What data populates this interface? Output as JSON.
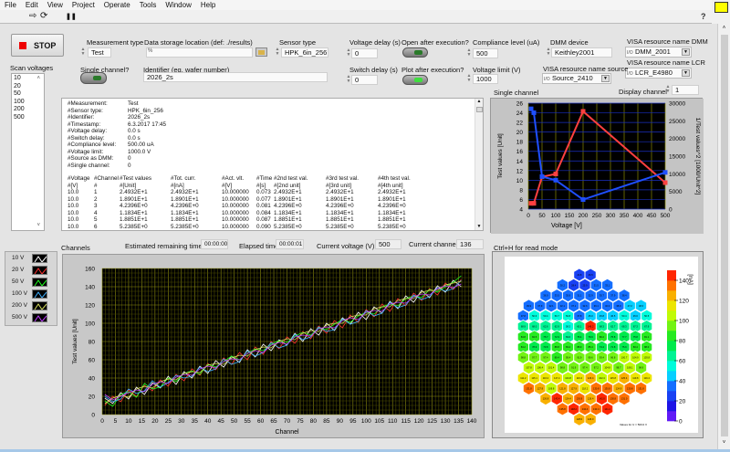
{
  "menu": [
    "File",
    "Edit",
    "View",
    "Project",
    "Operate",
    "Tools",
    "Window",
    "Help"
  ],
  "toolbar": {
    "run": "⇨",
    "run_continuous": "⟳",
    "pause": "❚❚",
    "help": "?"
  },
  "stop": {
    "label": "STOP"
  },
  "controls": {
    "measurement_type": {
      "label": "Measurement type",
      "value": "Test"
    },
    "data_storage": {
      "label": "Data storage location (def: ./results)",
      "value": ""
    },
    "sensor_type": {
      "label": "Sensor type",
      "value": "HPK_6in_256"
    },
    "voltage_delay": {
      "label": "Voltage delay (s)",
      "value": "0"
    },
    "switch_delay": {
      "label": "Switch delay (s)",
      "value": "0"
    },
    "open_after": {
      "label": "Open after execution?"
    },
    "plot_after": {
      "label": "Plot after execution?"
    },
    "compliance": {
      "label": "Compliance  level (uA)",
      "value": "500"
    },
    "voltage_limit": {
      "label": "Voltage limit (V)",
      "value": "1000"
    },
    "dmm_device": {
      "label": "DMM device",
      "value": "Keithley2001"
    },
    "visa_dmm": {
      "label": "VISA resource name DMM",
      "value": "DMM_2001"
    },
    "visa_lcr": {
      "label": "VISA resource name LCR",
      "value": "LCR_E4980"
    },
    "visa_source": {
      "label": "VISA resource name source",
      "value": "Source_2410"
    },
    "display_channel": {
      "label": "Display channel",
      "value": "1"
    },
    "single_channel": {
      "label": "Single channel?"
    },
    "identifier": {
      "label": "Identifier (eg. wafer number)",
      "value": "2026_2s"
    },
    "scan_voltages": {
      "label": "Scan voltages",
      "items": [
        "10",
        "20",
        "50",
        "100",
        "200",
        "500"
      ]
    }
  },
  "log": {
    "header": [
      [
        "#Measurement:",
        "Test"
      ],
      [
        "#Sensor type:",
        "HPK_6in_256"
      ],
      [
        "#Identifier:",
        "2026_2s"
      ],
      [
        "#Timestamp:",
        "6.3.2017 17:45"
      ],
      [
        "#Voltage delay:",
        "0.0 s"
      ],
      [
        "#Switch delay:",
        "0.0 s"
      ],
      [
        "#Compliance level:",
        "500.00 uA"
      ],
      [
        "#Voltage limit:",
        "1000.0 V"
      ],
      [
        "#Source as DMM:",
        "0"
      ],
      [
        "#Single channel:",
        "0"
      ]
    ],
    "columns": [
      "#Voltage",
      "#Channel",
      "#Test values",
      "#Tot. curr.",
      "#Act. vlt.",
      "#Time",
      "#2nd test val.",
      "#3rd test val.",
      "#4th test val."
    ],
    "units": [
      "#[V]",
      "#",
      "#[Unit]",
      "#[nA]",
      "#[V]",
      "#[s]",
      "#[2nd unit]",
      "#[3rd unit]",
      "#[4th unit]"
    ],
    "rows": [
      [
        "10.0",
        "1",
        "2.4932E+1",
        "2.4932E+1",
        "10.000000",
        "0.073",
        "2.4932E+1",
        "2.4932E+1",
        "2.4932E+1"
      ],
      [
        "10.0",
        "2",
        "1.8901E+1",
        "1.8901E+1",
        "10.000000",
        "0.077",
        "1.8901E+1",
        "1.8901E+1",
        "1.8901E+1"
      ],
      [
        "10.0",
        "3",
        "4.2396E+0",
        "4.2396E+0",
        "10.000000",
        "0.081",
        "4.2396E+0",
        "4.2396E+0",
        "4.2396E+0"
      ],
      [
        "10.0",
        "4",
        "1.1834E+1",
        "1.1834E+1",
        "10.000000",
        "0.084",
        "1.1834E+1",
        "1.1834E+1",
        "1.1834E+1"
      ],
      [
        "10.0",
        "5",
        "1.8851E+1",
        "1.8851E+1",
        "10.000000",
        "0.087",
        "1.8851E+1",
        "1.8851E+1",
        "1.8851E+1"
      ],
      [
        "10.0",
        "6",
        "5.2385E+0",
        "5.2385E+0",
        "10.000000",
        "0.090",
        "5.2385E+0",
        "5.2385E+0",
        "5.2385E+0"
      ]
    ]
  },
  "status": {
    "channels_label": "Channels",
    "remaining": {
      "label": "Estimated remaining time",
      "value": "00:00:00"
    },
    "elapsed": {
      "label": "Elapsed time",
      "value": "00:00:01"
    },
    "current_voltage": {
      "label": "Current voltage (V)",
      "value": "500"
    },
    "current_channel": {
      "label": "Current channel",
      "value": "136"
    },
    "single_channel_label": "Single channel",
    "read_mode_hint": "Ctrl+H for read mode"
  },
  "chart_data": [
    {
      "type": "line",
      "title": "",
      "xlabel": "Voltage [V]",
      "ylabel": "Test values [Unit]",
      "y2label": "1/Test values^2 [1000/Unit^2]",
      "xlim": [
        0,
        500
      ],
      "ylim": [
        4,
        26
      ],
      "y2lim": [
        0,
        30000
      ],
      "xticks": [
        "0",
        "50",
        "100",
        "150",
        "200",
        "250",
        "300",
        "350",
        "400",
        "450",
        "500"
      ],
      "yticks": [
        "4",
        "6",
        "8",
        "10",
        "12",
        "14",
        "16",
        "18",
        "20",
        "22",
        "24",
        "26"
      ],
      "y2ticks": [
        "0",
        "5000",
        "10000",
        "15000",
        "20000",
        "25000",
        "30000"
      ],
      "x": [
        10,
        20,
        50,
        100,
        200,
        500
      ],
      "series": [
        {
          "axis": "left",
          "color": "#ff4040",
          "values": [
            5.2,
            5.2,
            10.7,
            11.3,
            24.3,
            9.5
          ]
        },
        {
          "axis": "right",
          "color": "#1f4fff",
          "values": [
            28400,
            27300,
            9200,
            8200,
            2700,
            10400
          ]
        }
      ]
    },
    {
      "type": "line",
      "title": "",
      "xlabel": "Channel",
      "ylabel": "Test values [Unit]",
      "xlim": [
        0,
        140
      ],
      "ylim": [
        0,
        160
      ],
      "grid": true,
      "xticks": [
        "0",
        "5",
        "10",
        "15",
        "20",
        "25",
        "30",
        "35",
        "40",
        "45",
        "50",
        "55",
        "60",
        "65",
        "70",
        "75",
        "80",
        "85",
        "90",
        "95",
        "100",
        "105",
        "110",
        "115",
        "120",
        "125",
        "130",
        "135",
        "140"
      ],
      "yticks": [
        "0",
        "20",
        "40",
        "60",
        "80",
        "100",
        "120",
        "140",
        "160"
      ],
      "x": [
        1,
        4,
        7,
        10,
        13,
        16,
        19,
        22,
        25,
        28,
        31,
        34,
        37,
        40,
        43,
        46,
        49,
        52,
        55,
        58,
        61,
        64,
        67,
        70,
        73,
        76,
        79,
        82,
        85,
        88,
        91,
        94,
        97,
        100,
        103,
        106,
        109,
        112,
        115,
        118,
        121,
        124,
        127,
        130,
        133,
        136
      ],
      "series": [
        {
          "name": "10 V",
          "color": "#ffffff",
          "values": [
            18,
            12,
            24,
            17,
            30,
            22,
            35,
            29,
            42,
            33,
            47,
            40,
            53,
            45,
            59,
            52,
            64,
            57,
            71,
            63,
            77,
            70,
            82,
            76,
            89,
            80,
            94,
            87,
            100,
            92,
            106,
            99,
            112,
            104,
            118,
            111,
            124,
            116,
            130,
            123,
            136,
            128,
            141,
            134,
            147,
            140
          ]
        },
        {
          "name": "20 V",
          "color": "#ff3030",
          "values": [
            10,
            20,
            14,
            27,
            20,
            32,
            26,
            38,
            31,
            44,
            37,
            50,
            43,
            56,
            49,
            62,
            55,
            68,
            60,
            74,
            66,
            80,
            72,
            85,
            78,
            91,
            83,
            97,
            89,
            103,
            95,
            109,
            101,
            115,
            107,
            121,
            113,
            127,
            119,
            133,
            125,
            138,
            131,
            144,
            137,
            148
          ]
        },
        {
          "name": "50 V",
          "color": "#20ff20",
          "values": [
            15,
            9,
            22,
            25,
            19,
            34,
            28,
            30,
            40,
            36,
            45,
            48,
            44,
            55,
            52,
            58,
            64,
            60,
            67,
            72,
            70,
            77,
            81,
            79,
            86,
            90,
            87,
            95,
            93,
            99,
            104,
            101,
            108,
            112,
            110,
            118,
            121,
            119,
            127,
            130,
            128,
            137,
            134,
            140,
            145,
            152
          ]
        },
        {
          "name": "100 V",
          "color": "#40b0ff",
          "values": [
            20,
            14,
            17,
            28,
            23,
            26,
            37,
            30,
            35,
            43,
            40,
            42,
            52,
            47,
            50,
            61,
            55,
            58,
            70,
            64,
            68,
            79,
            73,
            76,
            88,
            82,
            85,
            96,
            91,
            93,
            105,
            99,
            102,
            114,
            108,
            111,
            123,
            117,
            120,
            131,
            126,
            129,
            139,
            135,
            138,
            147
          ]
        },
        {
          "name": "200 V",
          "color": "#d8e060",
          "values": [
            12,
            18,
            21,
            19,
            28,
            31,
            29,
            36,
            39,
            38,
            45,
            47,
            46,
            54,
            56,
            55,
            62,
            65,
            64,
            71,
            74,
            73,
            80,
            83,
            82,
            89,
            92,
            91,
            98,
            100,
            100,
            107,
            109,
            109,
            116,
            118,
            118,
            125,
            127,
            127,
            134,
            136,
            136,
            142,
            144,
            146
          ]
        },
        {
          "name": "500 V",
          "color": "#c040ff",
          "values": [
            22,
            16,
            20,
            24,
            27,
            25,
            33,
            36,
            34,
            41,
            44,
            43,
            50,
            53,
            51,
            58,
            61,
            60,
            67,
            70,
            68,
            76,
            79,
            77,
            85,
            87,
            86,
            94,
            96,
            95,
            103,
            106,
            104,
            112,
            114,
            113,
            121,
            123,
            122,
            129,
            132,
            131,
            138,
            141,
            139,
            143
          ]
        }
      ]
    },
    {
      "type": "heatmap",
      "title": "",
      "colorbar_label": "[nA]",
      "clim": [
        0,
        150
      ],
      "colorbar_ticks": [
        "0",
        "20",
        "40",
        "60",
        "80",
        "100",
        "120",
        "140"
      ],
      "footnote": "Values for U = 500.0 V",
      "rows": [
        [
          24.8,
          26.5
        ],
        [
          30.2,
          28.4,
          25.9,
          31.5,
          33.1
        ],
        [
          36.0,
          33.5,
          35.9,
          31.1,
          32.9,
          35.7,
          37.9,
          38.4
        ],
        [
          39.9,
          37.9,
          32.1,
          32.1,
          37.1,
          32.6,
          36.1,
          32.3,
          38.9,
          47.2,
          48.6
        ],
        [
          37.8,
          50.6,
          50.4,
          50.7,
          50.8,
          37.8,
          45.0,
          45.8,
          46.5,
          50.4,
          45.6,
          50.5
        ],
        [
          68.9,
          68.0,
          62.6,
          62.9,
          58.3,
          60.1,
          146.2,
          68.3,
          62.7,
          68.3,
          67.3,
          67.9
        ],
        [
          84.8,
          84.5,
          75.7,
          72.9,
          69.6,
          75.4,
          78.9,
          80.2,
          75.8,
          77.7,
          75.8,
          81.1
        ],
        [
          84.2,
          78.9,
          73.8,
          88.8,
          83.4,
          88.9,
          85.4,
          74.4,
          71.8,
          75.9,
          83.4,
          88.0
        ],
        [
          98.8,
          97.7,
          97.4,
          89.4,
          95.4,
          91.9,
          99.6,
          93.4,
          96.8,
          100.7,
          104.9,
          103.8
        ],
        [
          107.8,
          106.4,
          101.4,
          98.8,
          91.9,
          97.4,
          97.2,
          104.8,
          98.7,
          108.1,
          98.9
        ],
        [
          111.2,
          115.1,
          116.2,
          117.4,
          104.8,
          116.4,
          123.4,
          102.4,
          115.8,
          125.4,
          119.8,
          119.4
        ],
        [
          131.8,
          127.8,
          109.8,
          121.8,
          127.9,
          118.2,
          130.8,
          130.8,
          124.9,
          130.8,
          131.8
        ],
        [
          126.8,
          143.4,
          124.4,
          130.8,
          126.4,
          142.0,
          130.8,
          131.0
        ],
        [
          135.8,
          148.2,
          134.4,
          133.4,
          141.4
        ],
        [
          128.0,
          126.0
        ]
      ]
    }
  ]
}
